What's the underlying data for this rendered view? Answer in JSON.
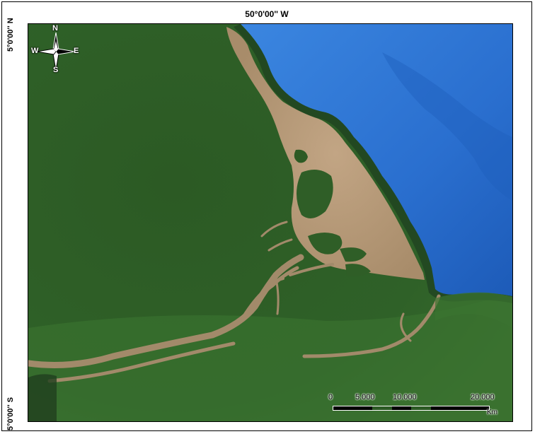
{
  "labels": {
    "top_longitude": "50°0'00'' W",
    "left_top_latitude": "5°0'00'' N",
    "left_bottom_latitude": "5°0'00'' S"
  },
  "compass": {
    "north": "N",
    "south": "S",
    "east": "E",
    "west": "W"
  },
  "scale_bar": {
    "ticks": [
      "0",
      "5.000",
      "10.000",
      "20.000"
    ],
    "unit": "Km"
  },
  "colors": {
    "ocean": "#2f78d4",
    "deep_ocean": "#1a56b5",
    "forest": "#2d5b25",
    "sediment": "#b89a78"
  }
}
